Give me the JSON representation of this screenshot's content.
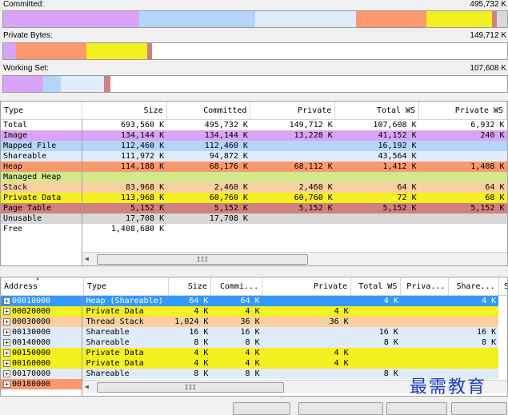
{
  "summary": [
    {
      "label": "Committed:",
      "value": "495,732 K",
      "segments": [
        {
          "color": "#d9a4f8",
          "fraction": 0.27
        },
        {
          "color": "#b3d5f9",
          "fraction": 0.23
        },
        {
          "color": "#e1ecfa",
          "fraction": 0.2
        },
        {
          "color": "#fb9a6e",
          "fraction": 0.14
        },
        {
          "color": "#f5f020",
          "fraction": 0.13
        },
        {
          "color": "#d08080",
          "fraction": 0.01
        },
        {
          "color": "#d8d8d8",
          "fraction": 0.02
        }
      ]
    },
    {
      "label": "Private Bytes:",
      "value": "149,712 K",
      "segments": [
        {
          "color": "#d9a4f8",
          "fraction": 0.025
        },
        {
          "color": "#fb9a6e",
          "fraction": 0.14
        },
        {
          "color": "#f5f020",
          "fraction": 0.12
        },
        {
          "color": "#d08080",
          "fraction": 0.01
        }
      ]
    },
    {
      "label": "Working Set:",
      "value": "107,608 K",
      "segments": [
        {
          "color": "#d9a4f8",
          "fraction": 0.08
        },
        {
          "color": "#b3d5f9",
          "fraction": 0.035
        },
        {
          "color": "#e1ecfa",
          "fraction": 0.085
        },
        {
          "color": "#d08080",
          "fraction": 0.012
        }
      ]
    }
  ],
  "types_table": {
    "columns": [
      "Type",
      "Size",
      "Committed",
      "Private",
      "Total WS",
      "Private WS"
    ],
    "rows": [
      {
        "color": "#ffffff",
        "cells": [
          "Total",
          "693,560 K",
          "495,732 K",
          "149,712 K",
          "107,608 K",
          "6,932 K"
        ]
      },
      {
        "color": "#d9a4f8",
        "cells": [
          "Image",
          "134,144 K",
          "134,144 K",
          "13,228 K",
          "41,152 K",
          "240 K"
        ]
      },
      {
        "color": "#b3d5f9",
        "cells": [
          "Mapped File",
          "112,460 K",
          "112,460 K",
          "",
          "16,192 K",
          ""
        ]
      },
      {
        "color": "#e1ecfa",
        "cells": [
          "Shareable",
          "111,972 K",
          "94,872 K",
          "",
          "43,564 K",
          ""
        ]
      },
      {
        "color": "#fb9a6e",
        "cells": [
          "Heap",
          "114,188 K",
          "68,176 K",
          "68,112 K",
          "1,412 K",
          "1,408 K"
        ]
      },
      {
        "color": "#d3e88c",
        "cells": [
          "Managed Heap",
          "",
          "",
          "",
          "",
          ""
        ]
      },
      {
        "color": "#fbd0a0",
        "cells": [
          "Stack",
          "83,968 K",
          "2,460 K",
          "2,460 K",
          "64 K",
          "64 K"
        ]
      },
      {
        "color": "#f5f020",
        "cells": [
          "Private Data",
          "113,968 K",
          "60,760 K",
          "60,760 K",
          "72 K",
          "68 K"
        ]
      },
      {
        "color": "#d08080",
        "cells": [
          "Page Table",
          "5,152 K",
          "5,152 K",
          "5,152 K",
          "5,152 K",
          "5,152 K"
        ]
      },
      {
        "color": "#d8d8d8",
        "cells": [
          "Unusable",
          "17,708 K",
          "17,708 K",
          "",
          "",
          ""
        ]
      },
      {
        "color": "#ffffff",
        "cells": [
          "Free",
          "1,408,680 K",
          "",
          "",
          "",
          ""
        ]
      }
    ],
    "scroll_grip": "III"
  },
  "details_table": {
    "columns": [
      "Address",
      "Type",
      "Size",
      "Commi...",
      "Private",
      "Total WS",
      "Priva...",
      "Share...",
      "S"
    ],
    "rows": [
      {
        "color": "#3399ff",
        "addr_color": "#3399ff",
        "selected": true,
        "cells": [
          "00010000",
          "Heap (Shareable)",
          "64 K",
          "64 K",
          "",
          "4 K",
          "",
          "4 K"
        ]
      },
      {
        "color": "#f5f020",
        "addr_color": "#f5f020",
        "cells": [
          "00020000",
          "Private Data",
          "4 K",
          "4 K",
          "4 K",
          "",
          "",
          ""
        ]
      },
      {
        "color": "#fbd0a0",
        "addr_color": "#fbd0a0",
        "cells": [
          "00030000",
          "Thread Stack",
          "1,024 K",
          "36 K",
          "36 K",
          "",
          "",
          ""
        ]
      },
      {
        "color": "#e1ecfa",
        "addr_color": "#e1ecfa",
        "cells": [
          "00130000",
          "Shareable",
          "16 K",
          "16 K",
          "",
          "16 K",
          "",
          "16 K"
        ]
      },
      {
        "color": "#e1ecfa",
        "addr_color": "#e1ecfa",
        "cells": [
          "00140000",
          "Shareable",
          "8 K",
          "8 K",
          "",
          "8 K",
          "",
          "8 K"
        ]
      },
      {
        "color": "#f5f020",
        "addr_color": "#f5f020",
        "cells": [
          "00150000",
          "Private Data",
          "4 K",
          "4 K",
          "4 K",
          "",
          "",
          ""
        ]
      },
      {
        "color": "#f5f020",
        "addr_color": "#f5f020",
        "cells": [
          "00160000",
          "Private Data",
          "4 K",
          "4 K",
          "4 K",
          "",
          "",
          ""
        ]
      },
      {
        "color": "#e1ecfa",
        "addr_color": "#e1ecfa",
        "cells": [
          "00170000",
          "Shareable",
          "8 K",
          "8 K",
          "",
          "8 K",
          "",
          ""
        ]
      },
      {
        "color": "#ffffff",
        "addr_color": "#fb9a6e",
        "cells": [
          "00180000",
          "",
          "",
          "",
          "",
          "",
          "",
          ""
        ]
      }
    ],
    "scroll_grip": "III"
  },
  "watermark": "最需教育"
}
